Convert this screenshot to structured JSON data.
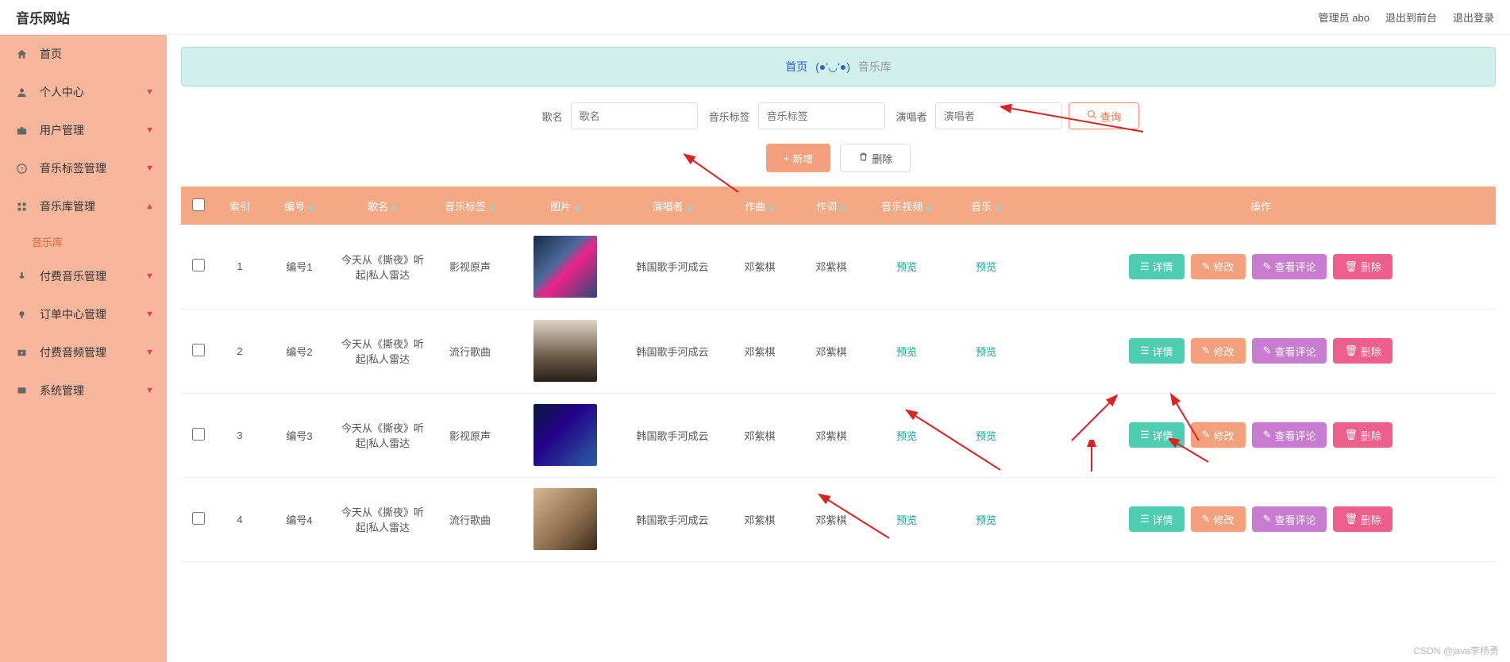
{
  "header": {
    "logo": "音乐网站",
    "admin": "管理员 abo",
    "front": "退出到前台",
    "logout": "退出登录"
  },
  "sidebar": {
    "items": [
      {
        "label": "首页"
      },
      {
        "label": "个人中心"
      },
      {
        "label": "用户管理"
      },
      {
        "label": "音乐标签管理"
      },
      {
        "label": "音乐库管理"
      },
      {
        "label": "付费音乐管理"
      },
      {
        "label": "订单中心管理"
      },
      {
        "label": "付费音频管理"
      },
      {
        "label": "系统管理"
      }
    ],
    "sub": "音乐库"
  },
  "breadcrumb": {
    "home": "首页",
    "sep": "(●'◡'●)",
    "current": "音乐库"
  },
  "search": {
    "song_label": "歌名",
    "song_ph": "歌名",
    "tag_label": "音乐标签",
    "tag_ph": "音乐标签",
    "singer_label": "演唱者",
    "singer_ph": "演唱者",
    "btn": "查询"
  },
  "toolbar": {
    "add": "新增",
    "del": "删除"
  },
  "cols": {
    "index": "索引",
    "code": "编号",
    "name": "歌名",
    "tag": "音乐标签",
    "img": "图片",
    "singer": "演唱者",
    "composer": "作曲",
    "lyricist": "作词",
    "video": "音乐视频",
    "audio": "音乐",
    "ops": "操作"
  },
  "preview": "预览",
  "actions": {
    "detail": "详情",
    "edit": "修改",
    "comment": "查看评论",
    "delete": "删除"
  },
  "rows": [
    {
      "index": "1",
      "code": "编号1",
      "name": "今天从《撕夜》听起|私人雷达",
      "tag": "影视原声",
      "singer": "韩国歌手河成云",
      "composer": "邓紫棋",
      "lyricist": "邓紫棋"
    },
    {
      "index": "2",
      "code": "编号2",
      "name": "今天从《撕夜》听起|私人雷达",
      "tag": "流行歌曲",
      "singer": "韩国歌手河成云",
      "composer": "邓紫棋",
      "lyricist": "邓紫棋"
    },
    {
      "index": "3",
      "code": "编号3",
      "name": "今天从《撕夜》听起|私人雷达",
      "tag": "影视原声",
      "singer": "韩国歌手河成云",
      "composer": "邓紫棋",
      "lyricist": "邓紫棋"
    },
    {
      "index": "4",
      "code": "编号4",
      "name": "今天从《撕夜》听起|私人雷达",
      "tag": "流行歌曲",
      "singer": "韩国歌手河成云",
      "composer": "邓紫棋",
      "lyricist": "邓紫棋"
    }
  ],
  "watermark": "CSDN @java李杨勇"
}
